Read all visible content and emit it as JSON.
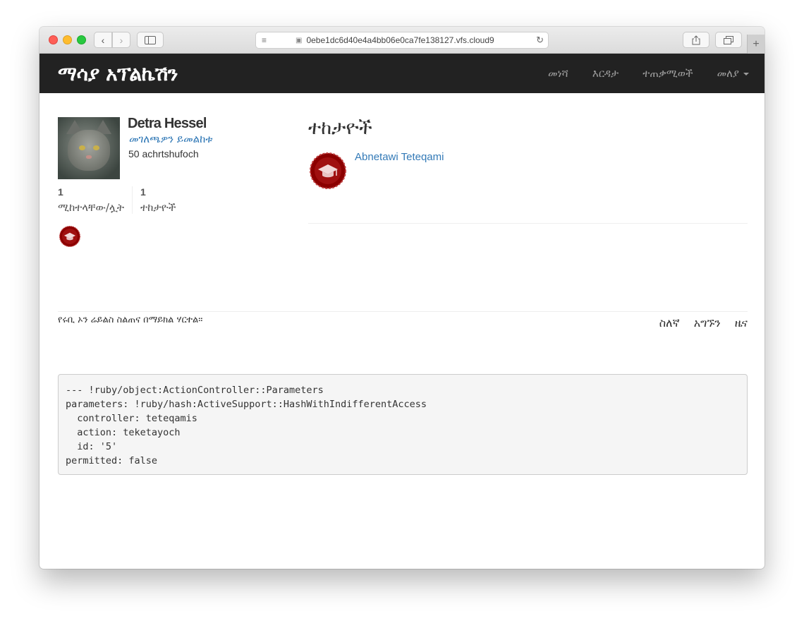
{
  "browser": {
    "url": "0ebe1dc6d40e4a4bb06e0ca7fe138127.vfs.cloud9",
    "icons": {
      "back": "chevron-left-icon",
      "forward": "chevron-right-icon",
      "sidebar": "sidebar-icon",
      "reader": "reader-icon",
      "lock": "lock-icon",
      "reload": "reload-icon",
      "share": "share-icon",
      "tabs": "tabs-icon",
      "new_tab": "plus-icon"
    }
  },
  "navbar": {
    "brand": "ማሳያ አፕልኬሽን",
    "links": [
      "መነሻ",
      "እርዳታ",
      "ተጠቃሚወች",
      "መለያ"
    ],
    "background": "#222222",
    "link_color": "#9d9d9d"
  },
  "profile": {
    "name": "Detra Hessel",
    "profile_link": "መገለጫዎን ይመልከቱ",
    "post_count": "50 achrtshufoch",
    "stats": [
      {
        "count": "1",
        "label": "ሚከተላቸው/ሏት"
      },
      {
        "count": "1",
        "label": "ተከታዮች"
      }
    ]
  },
  "followers": {
    "title": "ተከታዮች",
    "items": [
      {
        "name": "Abnetawi Teteqami"
      }
    ]
  },
  "footer": {
    "text": "የሩቢ ኦን ሬይልስ ስልጠና በማይክል ሃርተል።",
    "links": [
      "ስለኛ",
      "አግኙን",
      "ዜና"
    ]
  },
  "debug": {
    "lines": [
      "--- !ruby/object:ActionController::Parameters",
      "parameters: !ruby/hash:ActiveSupport::HashWithIndifferentAccess",
      "  controller: teteqamis",
      "  action: teketayoch",
      "  id: '5'",
      "permitted: false"
    ]
  },
  "colors": {
    "link": "#337ab7",
    "badge": "#8b0000"
  }
}
